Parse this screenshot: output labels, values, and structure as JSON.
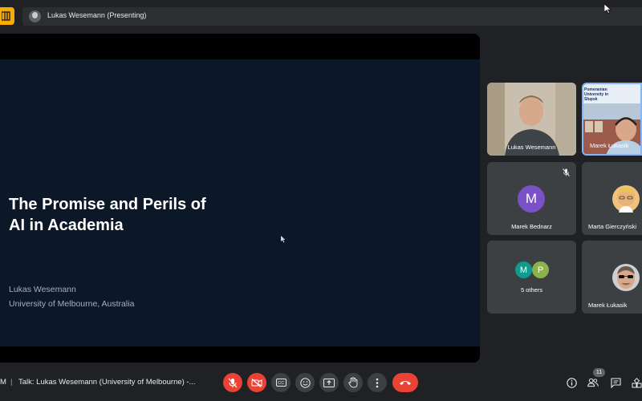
{
  "colors": {
    "background": "#202124",
    "slide_background": "#0c1727",
    "accent_yellow": "#f9ab00",
    "danger_red": "#ea4335",
    "active_border": "#8ab4f8"
  },
  "topbar": {
    "presenter_label": "Lukas Wesemann (Presenting)"
  },
  "slide": {
    "title_line1": "The Promise and Perils of",
    "title_line2": "AI in Academia",
    "author": "Lukas Wesemann",
    "affiliation": "University of Melbourne, Australia"
  },
  "participants": [
    {
      "name": "Lukas Wesemann",
      "type": "video"
    },
    {
      "name": "Marek Łukasik",
      "type": "video",
      "active": true,
      "background_text": "Pomeranian University in Słupsk"
    },
    {
      "name": "Marek Bednarz",
      "type": "avatar",
      "initial": "M",
      "avatar_color": "#7b51c8",
      "muted": true
    },
    {
      "name": "Marta Gierczyński",
      "type": "photo"
    },
    {
      "name": "5 others",
      "type": "group",
      "initials": [
        "M",
        "P"
      ],
      "avatar_colors": [
        "#129a8e",
        "#8cb24b"
      ]
    },
    {
      "name": "Marek Łukasik",
      "type": "photo"
    }
  ],
  "bottombar": {
    "meeting_code": "M",
    "separator": "|",
    "meeting_title": "Talk: Lukas Wesemann (University of Melbourne) -...",
    "participant_count": "11",
    "controls": [
      "mic-off",
      "camera-off",
      "captions",
      "emoji",
      "present",
      "raise-hand",
      "more-options",
      "leave-call"
    ],
    "right_icons": [
      "info",
      "people",
      "chat",
      "activities"
    ]
  }
}
